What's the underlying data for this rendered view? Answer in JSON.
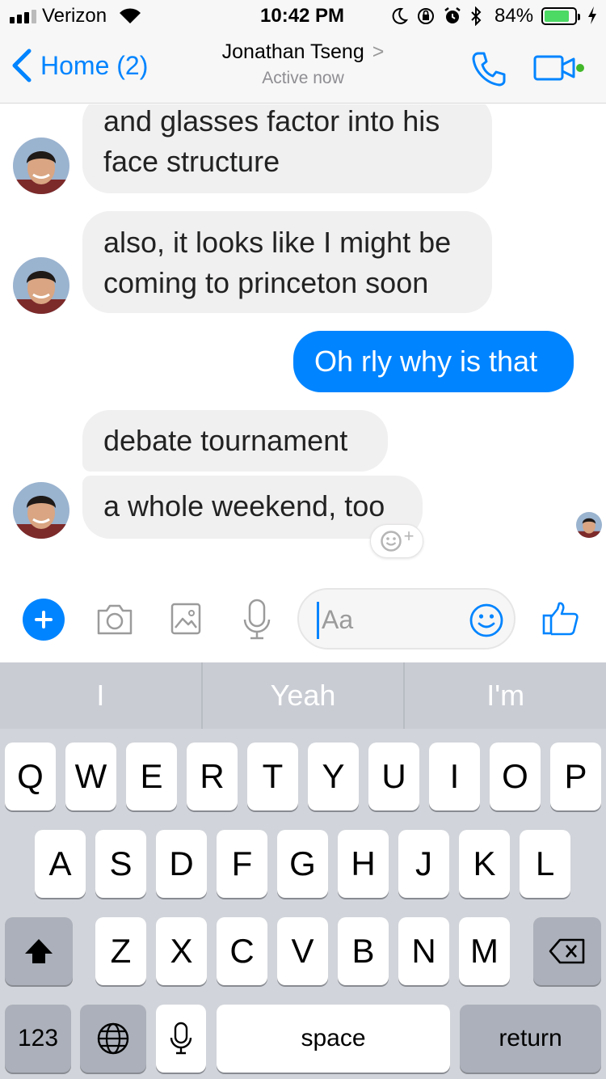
{
  "status_bar": {
    "carrier": "Verizon",
    "time": "10:42 PM",
    "battery_percent": "84%",
    "battery_level": 0.84,
    "signal_bars": 3,
    "icons": [
      "wifi-icon",
      "do-not-disturb-icon",
      "orientation-lock-icon",
      "alarm-icon",
      "bluetooth-icon",
      "charging-icon"
    ]
  },
  "nav": {
    "back_label": "Home (2)",
    "contact_name": "Jonathan Tseng",
    "status": "Active now",
    "accent": "#0084ff",
    "active_dot": "#42b72a"
  },
  "messages": [
    {
      "sender": "Jonathan Tseng",
      "direction": "incoming",
      "lines": [
        "and glasses factor into his",
        "face structure"
      ]
    },
    {
      "sender": "Jonathan Tseng",
      "direction": "incoming",
      "lines": [
        "also, it looks like I might be",
        "coming to princeton soon"
      ]
    },
    {
      "sender": "me",
      "direction": "outgoing",
      "lines": [
        "Oh rly why is that"
      ]
    },
    {
      "sender": "Jonathan Tseng",
      "direction": "incoming",
      "lines": [
        "debate tournament"
      ]
    },
    {
      "sender": "Jonathan Tseng",
      "direction": "incoming",
      "lines": [
        "a whole weekend, too"
      ]
    }
  ],
  "reaction_button": "+",
  "composer": {
    "placeholder": "Aa",
    "buttons": [
      "plus-icon",
      "camera-icon",
      "photo-icon",
      "microphone-icon",
      "emoji-icon",
      "thumbs-up-icon"
    ]
  },
  "keyboard": {
    "predictions": [
      "I",
      "Yeah",
      "I'm"
    ],
    "row1": [
      "Q",
      "W",
      "E",
      "R",
      "T",
      "Y",
      "U",
      "I",
      "O",
      "P"
    ],
    "row2": [
      "A",
      "S",
      "D",
      "F",
      "G",
      "H",
      "J",
      "K",
      "L"
    ],
    "row3": [
      "Z",
      "X",
      "C",
      "V",
      "B",
      "N",
      "M"
    ],
    "numbers_key": "123",
    "space_key": "space",
    "return_key": "return"
  }
}
